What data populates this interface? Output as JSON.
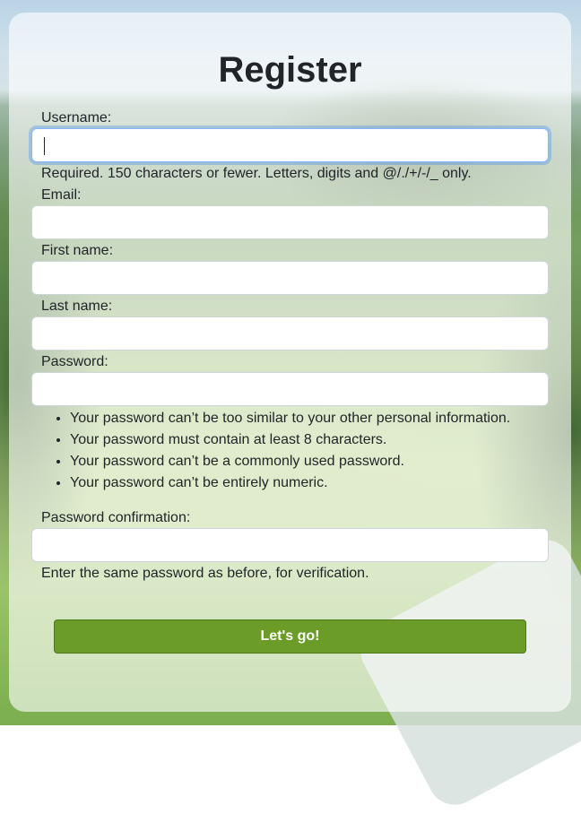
{
  "form": {
    "title": "Register",
    "fields": {
      "username": {
        "label": "Username:",
        "value": "",
        "help": "Required. 150 characters or fewer. Letters, digits and @/./+/-/_ only."
      },
      "email": {
        "label": "Email:",
        "value": ""
      },
      "first_name": {
        "label": "First name:",
        "value": ""
      },
      "last_name": {
        "label": "Last name:",
        "value": ""
      },
      "password": {
        "label": "Password:",
        "value": "",
        "rules": [
          "Your password can’t be too similar to your other personal information.",
          "Your password must contain at least 8 characters.",
          "Your password can’t be a commonly used password.",
          "Your password can’t be entirely numeric."
        ]
      },
      "password_confirmation": {
        "label": "Password confirmation:",
        "value": "",
        "help": "Enter the same password as before, for verification."
      }
    },
    "submit_label": "Let's go!"
  },
  "colors": {
    "submit_bg": "#6a9c27",
    "focus_ring": "#86b7fe",
    "text": "#212529"
  }
}
